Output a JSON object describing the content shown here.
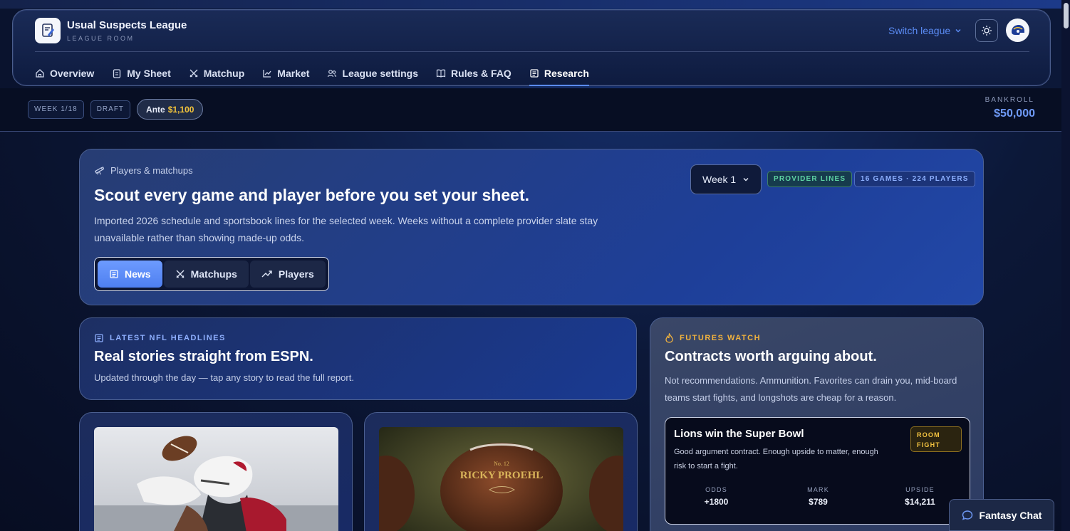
{
  "league": {
    "title": "Usual Suspects League",
    "subtitle": "LEAGUE ROOM",
    "switch_label": "Switch league"
  },
  "nav": {
    "items": [
      {
        "label": "Overview",
        "icon": "home-icon"
      },
      {
        "label": "My Sheet",
        "icon": "clipboard-icon"
      },
      {
        "label": "Matchup",
        "icon": "swords-icon"
      },
      {
        "label": "Market",
        "icon": "chart-line-icon"
      },
      {
        "label": "League settings",
        "icon": "users-icon"
      },
      {
        "label": "Rules & FAQ",
        "icon": "book-icon"
      },
      {
        "label": "Research",
        "icon": "newspaper-icon",
        "active": true
      }
    ]
  },
  "status": {
    "week": "WEEK 1/18",
    "phase": "DRAFT",
    "ante_label": "Ante",
    "ante_value": "$1,100",
    "bankroll_label": "BANKROLL",
    "bankroll_value": "$50,000"
  },
  "hero": {
    "eyebrow": "Players & matchups",
    "title": "Scout every game and player before you set your sheet.",
    "body": "Imported 2026 schedule and sportsbook lines for the selected week. Weeks without a complete provider slate stay unavailable rather than showing made-up odds.",
    "week_selected": "Week 1",
    "badge_provider": "PROVIDER LINES",
    "badge_counts": "16 GAMES · 224 PLAYERS",
    "tabs": [
      {
        "label": "News",
        "active": true
      },
      {
        "label": "Matchups"
      },
      {
        "label": "Players"
      }
    ]
  },
  "headlines": {
    "eyebrow": "LATEST NFL HEADLINES",
    "title": "Real stories straight from ESPN.",
    "body": "Updated through the day — tap any story to read the full report."
  },
  "tiles": {
    "football_text": "RICKY PROEHL",
    "football_small": "No. 12"
  },
  "futures": {
    "eyebrow": "FUTURES WATCH",
    "title": "Contracts worth arguing about.",
    "body": "Not recommendations. Ammunition. Favorites can drain you, mid-board teams start fights, and longshots are cheap for a reason.",
    "contract": {
      "title": "Lions win the Super Bowl",
      "desc": "Good argument contract. Enough upside to matter, enough risk to start a fight.",
      "tag": "ROOM FIGHT",
      "odds_label": "ODDS",
      "odds_value": "+1800",
      "mark_label": "MARK",
      "mark_value": "$789",
      "upside_label": "UPSIDE",
      "upside_value": "$14,211"
    }
  },
  "chat": {
    "label": "Fantasy Chat"
  },
  "colors": {
    "accent": "#5b8cf5",
    "gold": "#f3c43b",
    "green": "#5ed3a3"
  }
}
